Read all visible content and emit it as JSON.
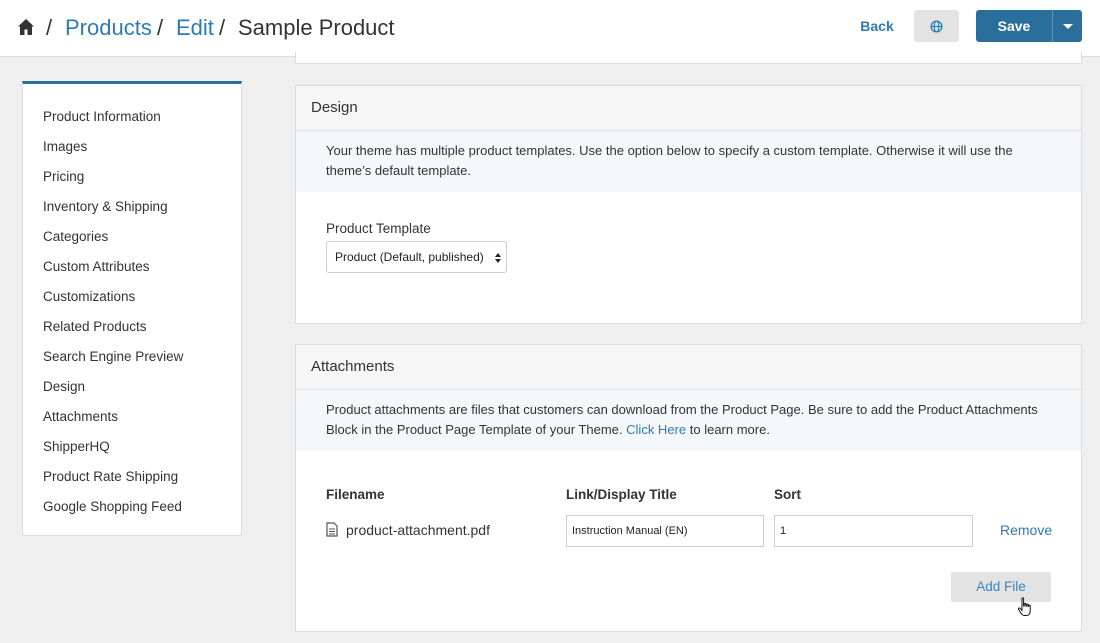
{
  "header": {
    "breadcrumb": [
      "Products",
      "Edit",
      "Sample Product"
    ],
    "separator": "/",
    "back_label": "Back",
    "save_label": "Save"
  },
  "sidebar": {
    "items": [
      {
        "label": "Product Information"
      },
      {
        "label": "Images"
      },
      {
        "label": "Pricing"
      },
      {
        "label": "Inventory & Shipping"
      },
      {
        "label": "Categories"
      },
      {
        "label": "Custom Attributes"
      },
      {
        "label": "Customizations"
      },
      {
        "label": "Related Products"
      },
      {
        "label": "Search Engine Preview"
      },
      {
        "label": "Design"
      },
      {
        "label": "Attachments"
      },
      {
        "label": "ShipperHQ"
      },
      {
        "label": "Product Rate Shipping"
      },
      {
        "label": "Google Shopping Feed"
      }
    ]
  },
  "design": {
    "title": "Design",
    "info": "Your theme has multiple product templates. Use the option below to specify a custom template. Otherwise it will use the theme’s default template.",
    "template_label": "Product Template",
    "template_value": "Product (Default, published)"
  },
  "attachments": {
    "title": "Attachments",
    "info_before": "Product attachments are files that customers can download from the Product Page. Be sure to add the Product Attachments Block in the Product Page Template of your Theme.",
    "info_link": "Click Here",
    "info_after": "to learn more.",
    "columns": [
      "Filename",
      "Link/Display Title",
      "Sort"
    ],
    "rows": [
      {
        "filename": "product-attachment.pdf",
        "title": "Instruction Manual (EN)",
        "sort": "1",
        "remove_label": "Remove"
      }
    ],
    "add_file_label": "Add File"
  },
  "colors": {
    "accent": "#2a6f9c",
    "link": "#2c7bb5",
    "background": "#efefef"
  },
  "icons": [
    "home-icon",
    "globe-icon",
    "chevron-down-icon",
    "file-icon",
    "select-arrows-icon",
    "hand-cursor-icon"
  ]
}
